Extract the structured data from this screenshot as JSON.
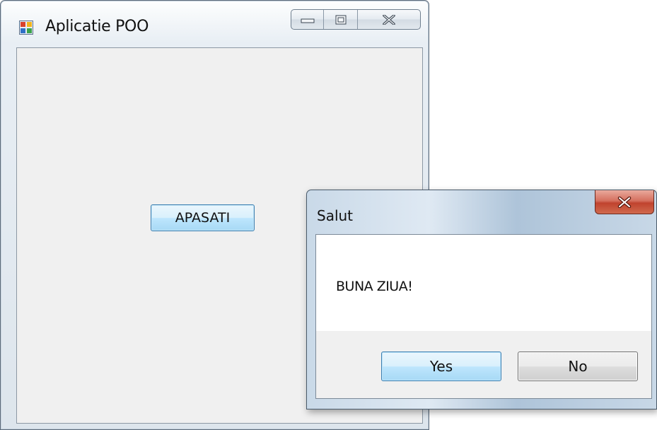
{
  "main_window": {
    "title": "Aplicatie POO",
    "button_label": "APASATI"
  },
  "dialog": {
    "title": "Salut",
    "message": "BUNA ZIUA!",
    "yes_label": "Yes",
    "no_label": "No"
  },
  "icons": {
    "app": "app-icon",
    "minimize": "minimize-icon",
    "maximize": "maximize-icon",
    "close": "close-icon"
  }
}
